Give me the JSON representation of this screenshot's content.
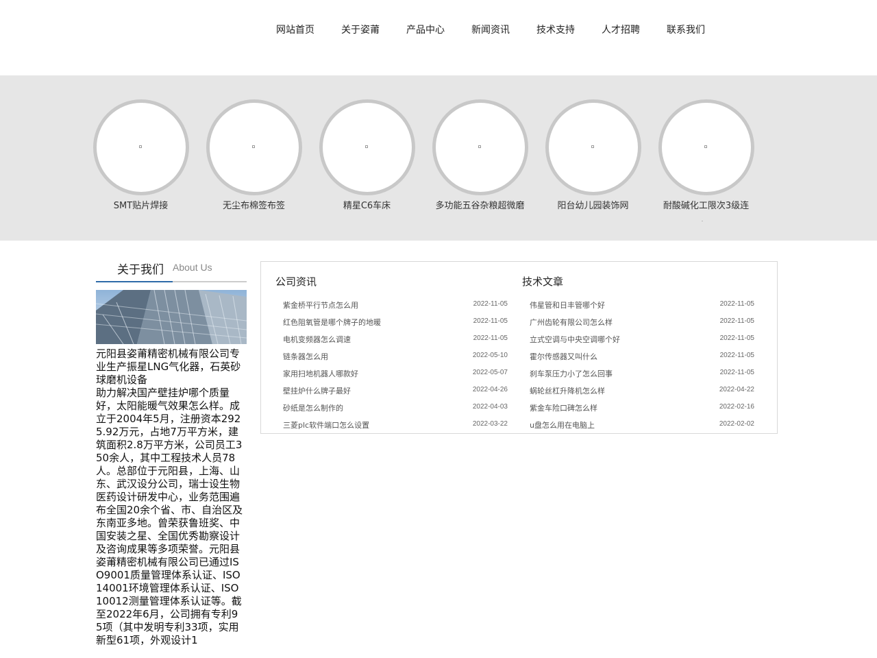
{
  "nav": [
    "网站首页",
    "关于姿莆",
    "产品中心",
    "新闻资讯",
    "技术支持",
    "人才招聘",
    "联系我们"
  ],
  "products": [
    "SMT贴片焊接",
    "无尘布棉签布签",
    "精星C6车床",
    "多功能五谷杂粮超微磨",
    "阳台幼儿园装饰网",
    "耐酸碱化工限次3级连"
  ],
  "about": {
    "title_zh": "关于我们",
    "title_en": "About Us",
    "text": "元阳县姿莆精密机械有限公司专业生产振星LNG气化器，石英砂球磨机设备\n助力解决国产壁挂炉哪个质量好，太阳能暖气效果怎么样。成立于2004年5月，注册资本2925.92万元，占地7万平方米，建筑面积2.8万平方米，公司员工350余人，其中工程技术人员78人。总部位于元阳县，上海、山东、武汉设分公司，瑞士设生物医药设计研发中心，业务范围遍布全国20余个省、市、自治区及东南亚多地。曾荣获鲁班奖、中国安装之星、全国优秀勘察设计及咨询成果等多项荣誉。元阳县姿莆精密机械有限公司已通过ISO9001质量管理体系认证、ISO14001环境管理体系认证、ISO10012测量管理体系认证等。截至2022年6月，公司拥有专利95项（其中发明专利33项，实用新型61项，外观设计1"
  },
  "company_news": {
    "title": "公司资讯",
    "items": [
      {
        "title": "紫金桥平行节点怎么用",
        "date": "2022-11-05"
      },
      {
        "title": "红色阻氧管是哪个牌子的地暖",
        "date": "2022-11-05"
      },
      {
        "title": "电机变频器怎么调速",
        "date": "2022-11-05"
      },
      {
        "title": "链条器怎么用",
        "date": "2022-05-10"
      },
      {
        "title": "家用扫地机器人哪款好",
        "date": "2022-05-07"
      },
      {
        "title": "壁挂炉什么牌子最好",
        "date": "2022-04-26"
      },
      {
        "title": "砂纸是怎么制作的",
        "date": "2022-04-03"
      },
      {
        "title": "三菱plc软件端口怎么设置",
        "date": "2022-03-22"
      }
    ]
  },
  "tech_articles": {
    "title": "技术文章",
    "items": [
      {
        "title": "伟星管和日丰管哪个好",
        "date": "2022-11-05"
      },
      {
        "title": "广州齿轮有限公司怎么样",
        "date": "2022-11-05"
      },
      {
        "title": "立式空调与中央空调哪个好",
        "date": "2022-11-05"
      },
      {
        "title": "霍尔传感器又叫什么",
        "date": "2022-11-05"
      },
      {
        "title": "刹车泵压力小了怎么回事",
        "date": "2022-11-05"
      },
      {
        "title": "蜗轮丝杠升降机怎么样",
        "date": "2022-04-22"
      },
      {
        "title": "紫金车险口碑怎么样",
        "date": "2022-02-16"
      },
      {
        "title": "u盘怎么用在电脑上",
        "date": "2022-02-02"
      }
    ]
  }
}
